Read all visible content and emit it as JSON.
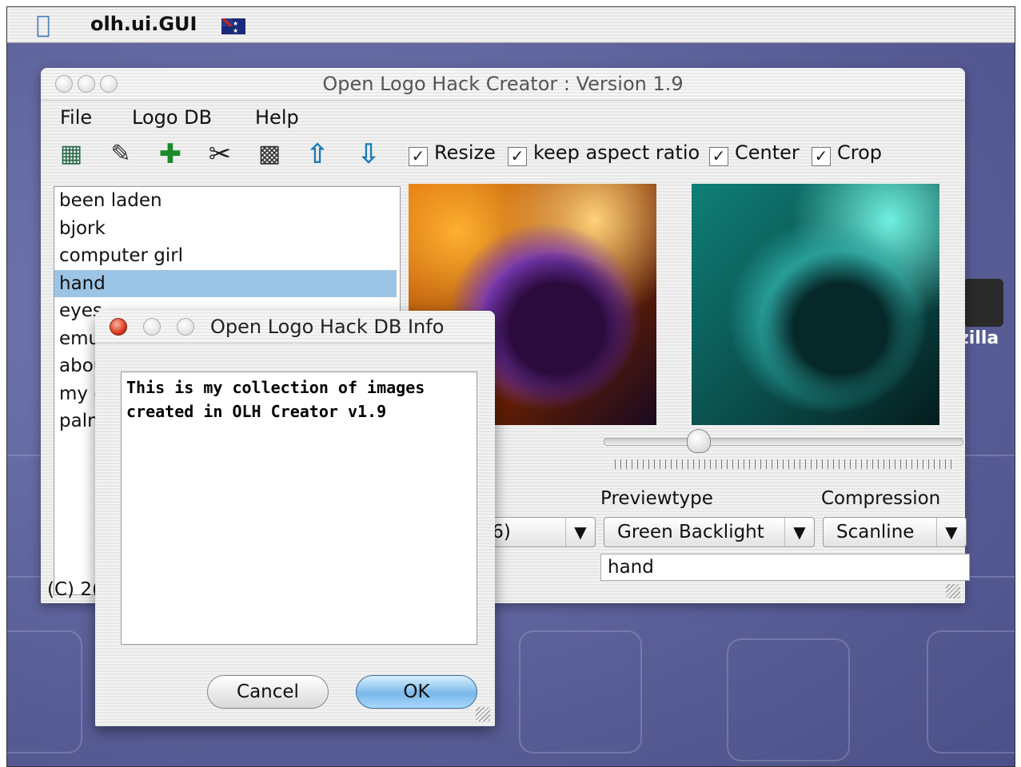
{
  "menubar": {
    "app_name": "olh.ui.GUI"
  },
  "main_window": {
    "title": "Open Logo Hack Creator : Version 1.9",
    "menu": [
      "File",
      "Logo DB",
      "Help"
    ],
    "options": [
      "Resize",
      "keep aspect ratio",
      "Center",
      "Crop"
    ],
    "list_items": [
      "been laden",
      "bjork",
      "computer girl",
      "hand",
      "eyes",
      "emul",
      "abou",
      "my c",
      "palm"
    ],
    "selected_item": "hand",
    "previewtype_label": "Previewtype",
    "compression_label": "Compression",
    "colors_value": "y(16)",
    "previewtype_value": "Green Backlight",
    "compression_value": "Scanline",
    "name_field": "hand",
    "copyright": "(C) 2("
  },
  "dialog": {
    "title": "Open Logo Hack DB Info",
    "text": "This is my collection of images\ncreated in OLH Creator v1.9",
    "cancel": "Cancel",
    "ok": "OK"
  },
  "desktop": {
    "icon_label_fragment": "zilla"
  },
  "colors": {
    "selection": "#9cc4e4",
    "desktop": "#5a5f98",
    "ok_button": "#7ab8e8"
  }
}
